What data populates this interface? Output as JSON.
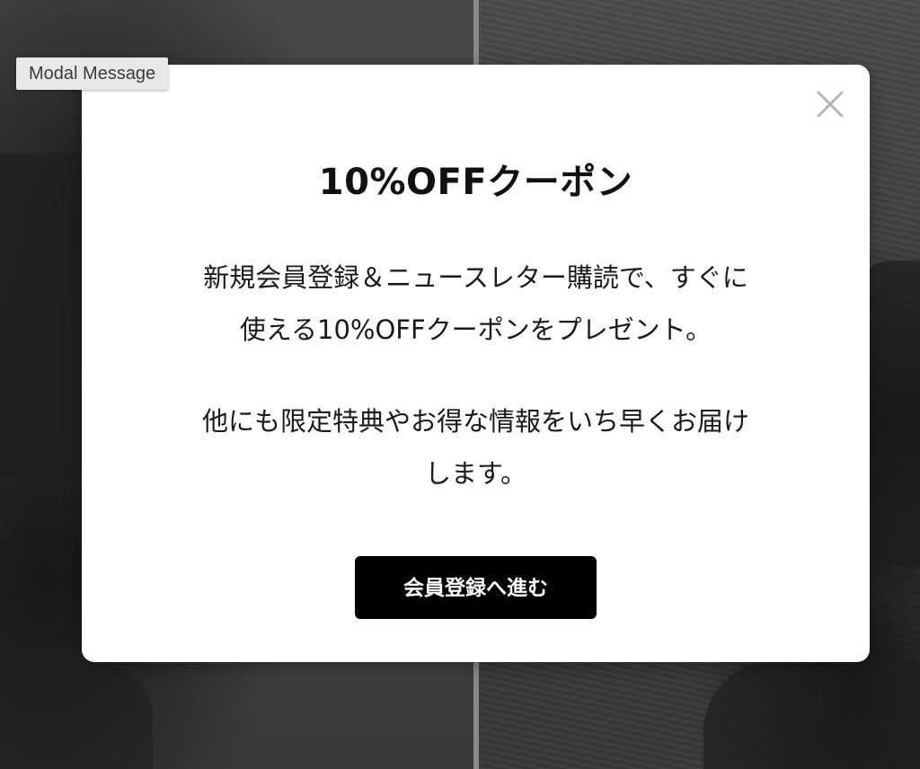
{
  "overlay": {
    "tag_label": "Modal Message"
  },
  "modal": {
    "title": "10%OFFクーポン",
    "body": {
      "line1": "新規会員登録＆ニュースレター購読で、すぐに",
      "line2": "使える10%OFFクーポンをプレゼント。",
      "line3": "他にも限定特典やお得な情報をいち早くお届け",
      "line4": "します。"
    },
    "cta_label": "会員登録へ進む",
    "close_icon": "close-icon"
  },
  "colors": {
    "modal_bg": "#ffffff",
    "cta_bg": "#000000",
    "cta_text": "#ffffff",
    "close_icon": "#b5b5b5",
    "backdrop_dark": "#3f3e3c"
  }
}
